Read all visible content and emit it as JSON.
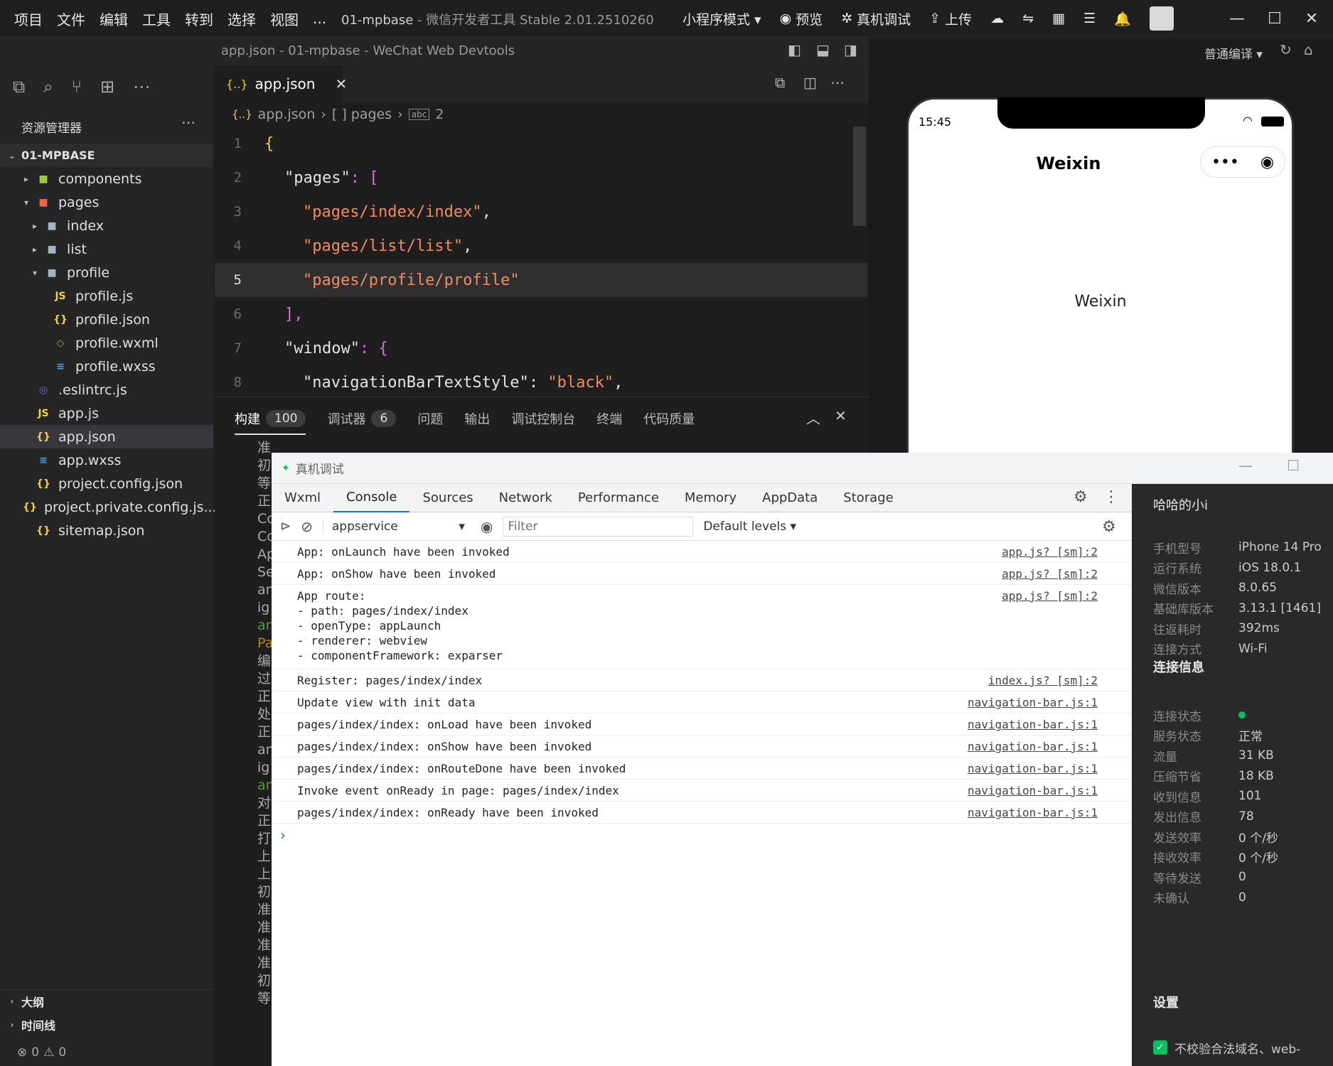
{
  "titlebar": {
    "menu": [
      "项目",
      "文件",
      "编辑",
      "工具",
      "转到",
      "选择",
      "视图",
      "..."
    ],
    "title_main": "01-mpbase",
    "title_rest": " - 微信开发者工具 Stable 2.01.2510260",
    "tools": [
      "小程序模式 ▾",
      "预览",
      "真机调试",
      "上传"
    ]
  },
  "subbar": {
    "title": "app.json - 01-mpbase - WeChat Web Devtools",
    "compile": "普通编译 ▾"
  },
  "explorer": {
    "heading": "资源管理器",
    "project": "01-MPBASE",
    "items": [
      {
        "label": "components",
        "kind": "folder",
        "arrow": "▸"
      },
      {
        "label": "pages",
        "kind": "folder",
        "arrow": "▾"
      },
      {
        "label": "index",
        "kind": "folder",
        "arrow": "▸"
      },
      {
        "label": "list",
        "kind": "folder",
        "arrow": "▸"
      },
      {
        "label": "profile",
        "kind": "folder",
        "arrow": "▾"
      },
      {
        "label": "profile.js",
        "kind": "js"
      },
      {
        "label": "profile.json",
        "kind": "json"
      },
      {
        "label": "profile.wxml",
        "kind": "wxml"
      },
      {
        "label": "profile.wxss",
        "kind": "wxss"
      },
      {
        "label": ".eslintrc.js",
        "kind": "eslint"
      },
      {
        "label": "app.js",
        "kind": "js"
      },
      {
        "label": "app.json",
        "kind": "json"
      },
      {
        "label": "app.wxss",
        "kind": "wxss"
      },
      {
        "label": "project.config.json",
        "kind": "json"
      },
      {
        "label": "project.private.config.js...",
        "kind": "json"
      },
      {
        "label": "sitemap.json",
        "kind": "json"
      }
    ],
    "outline": "大纲",
    "timeline": "时间线"
  },
  "status": {
    "errors": "0",
    "warnings": "0"
  },
  "editor": {
    "tab": "app.json",
    "breadcrumb": [
      "app.json",
      "[ ] pages",
      "2"
    ],
    "lines": [
      "1",
      "2",
      "3",
      "4",
      "5",
      "6",
      "7",
      "8"
    ],
    "code": {
      "l1": "{",
      "l2_key": "\"pages\"",
      "l2_rest": ": [",
      "l3": "\"pages/index/index\"",
      "l4": "\"pages/list/list\"",
      "l5": "\"pages/profile/profile\"",
      "l6": "],",
      "l7_key": "\"window\"",
      "l7_rest": ": {",
      "l8_key": "\"navigationBarTextStyle\"",
      "l8_val": "\"black\"",
      "comma": ","
    }
  },
  "panel": {
    "tabs": [
      "构建",
      "调试器",
      "问题",
      "输出",
      "调试控制台",
      "终端",
      "代码质量"
    ],
    "build_count": "100",
    "debug_count": "6",
    "build_lines": [
      "准",
      "初",
      "等",
      "正",
      "Co",
      "Co",
      "Ap",
      "Se",
      "an",
      "ig",
      "an",
      "Pa",
      "编",
      "过",
      "正",
      "处",
      "正",
      "an",
      "ig",
      "an",
      "对",
      "正",
      "打",
      "上",
      "上",
      "初",
      "准",
      "准",
      "准",
      "准",
      "初",
      "等"
    ]
  },
  "phone": {
    "time": "15:45",
    "nav_title": "Weixin",
    "body_text": "Weixin"
  },
  "devtools": {
    "title": "真机调试",
    "tabs": [
      "Wxml",
      "Console",
      "Sources",
      "Network",
      "Performance",
      "Memory",
      "AppData",
      "Storage"
    ],
    "context": "appservice",
    "filter_placeholder": "Filter",
    "levels": "Default levels ▾",
    "rows": [
      {
        "msg": "App: onLaunch have been invoked",
        "src": "app.js? [sm]:2"
      },
      {
        "msg": "App: onShow have been invoked",
        "src": "app.js? [sm]:2"
      },
      {
        "msg": "App route:\n- path: pages/index/index\n- openType: appLaunch\n- renderer: webview\n- componentFramework: exparser",
        "src": "app.js? [sm]:2"
      },
      {
        "msg": "Register: pages/index/index",
        "src": "index.js? [sm]:2"
      },
      {
        "msg": "Update view with init data",
        "src": "navigation-bar.js:1"
      },
      {
        "msg": "pages/index/index: onLoad have been invoked",
        "src": "navigation-bar.js:1"
      },
      {
        "msg": "pages/index/index: onShow have been invoked",
        "src": "navigation-bar.js:1"
      },
      {
        "msg": "pages/index/index: onRouteDone have been invoked",
        "src": "navigation-bar.js:1"
      },
      {
        "msg": "Invoke event onReady in page: pages/index/index",
        "src": "navigation-bar.js:1"
      },
      {
        "msg": "pages/index/index: onReady have been invoked",
        "src": "navigation-bar.js:1"
      }
    ],
    "prompt": "›"
  },
  "device": {
    "name": "哈哈的小i",
    "rows": [
      {
        "label": "手机型号",
        "value": "iPhone 14 Pro"
      },
      {
        "label": "运行系统",
        "value": "iOS 18.0.1"
      },
      {
        "label": "微信版本",
        "value": "8.0.65"
      },
      {
        "label": "基础库版本",
        "value": "3.13.1 [1461]"
      },
      {
        "label": "往返耗时",
        "value": "392ms"
      },
      {
        "label": "连接方式",
        "value": "Wi-Fi"
      }
    ],
    "conn_title": "连接信息",
    "conn_rows": [
      {
        "label": "连接状态",
        "value": ""
      },
      {
        "label": "服务状态",
        "value": "正常"
      },
      {
        "label": "流量",
        "value": "31 KB"
      },
      {
        "label": "压缩节省",
        "value": "18 KB"
      },
      {
        "label": "收到信息",
        "value": "101"
      },
      {
        "label": "发出信息",
        "value": "78"
      },
      {
        "label": "发送效率",
        "value": "0 个/秒"
      },
      {
        "label": "接收效率",
        "value": "0 个/秒"
      },
      {
        "label": "等待发送",
        "value": "0"
      },
      {
        "label": "未确认",
        "value": "0"
      }
    ],
    "settings_title": "设置",
    "setting_checkbox": "不校验合法域名、web-"
  },
  "colors": {
    "accent": "#1a73e8",
    "ok": "#07c160",
    "string": "#f28b62",
    "bracket": "#d770d7"
  }
}
